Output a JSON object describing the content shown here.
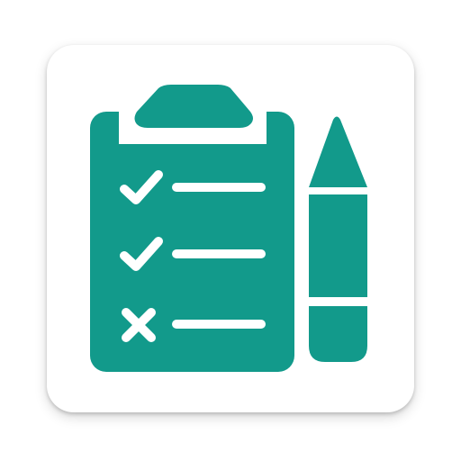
{
  "icon": {
    "name": "checklist-app-icon",
    "glyphs": [
      "clipboard-icon",
      "check-icon",
      "check-icon",
      "x-mark-icon",
      "pencil-icon"
    ],
    "items": [
      {
        "status": "done"
      },
      {
        "status": "done"
      },
      {
        "status": "failed"
      }
    ]
  },
  "colors": {
    "tile": "#ffffff",
    "accent": "#129a8b",
    "cutout": "#ffffff"
  }
}
